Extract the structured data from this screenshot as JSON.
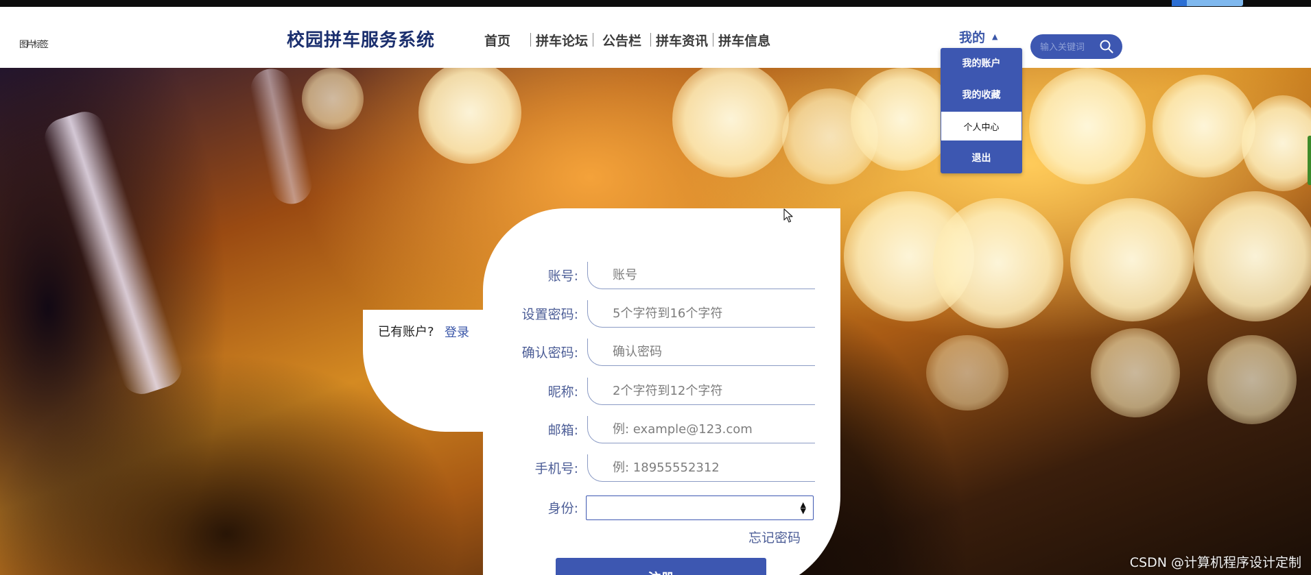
{
  "header": {
    "logo_alt": "图片标签",
    "site_title": "校园拼车服务系统",
    "nav": [
      "首页",
      "拼车论坛",
      "公告栏",
      "拼车资讯",
      "拼车信息"
    ],
    "my_menu": "我的",
    "search_placeholder": "输入关键词"
  },
  "dropdown": {
    "items": [
      {
        "label": "我的账户",
        "active": false
      },
      {
        "label": "我的收藏",
        "active": false
      },
      {
        "label": "个人中心",
        "active": true
      },
      {
        "label": "退出",
        "active": false
      }
    ]
  },
  "side": {
    "have_account": "已有账户?",
    "login": "登录"
  },
  "form": {
    "fields": [
      {
        "label": "账号:",
        "placeholder": "账号"
      },
      {
        "label": "设置密码:",
        "placeholder": "5个字符到16个字符"
      },
      {
        "label": "确认密码:",
        "placeholder": "确认密码"
      },
      {
        "label": "昵称:",
        "placeholder": "2个字符到12个字符"
      },
      {
        "label": "邮箱:",
        "placeholder": "例: example@123.com"
      },
      {
        "label": "手机号:",
        "placeholder": "例: 18955552312"
      }
    ],
    "role_label": "身份:",
    "role_value": "",
    "forgot": "忘记密码",
    "submit": "注册"
  },
  "watermark": "CSDN @计算机程序设计定制",
  "colors": {
    "primary": "#3d57b1",
    "title": "#1b2f6e",
    "label": "#4d5e97"
  }
}
